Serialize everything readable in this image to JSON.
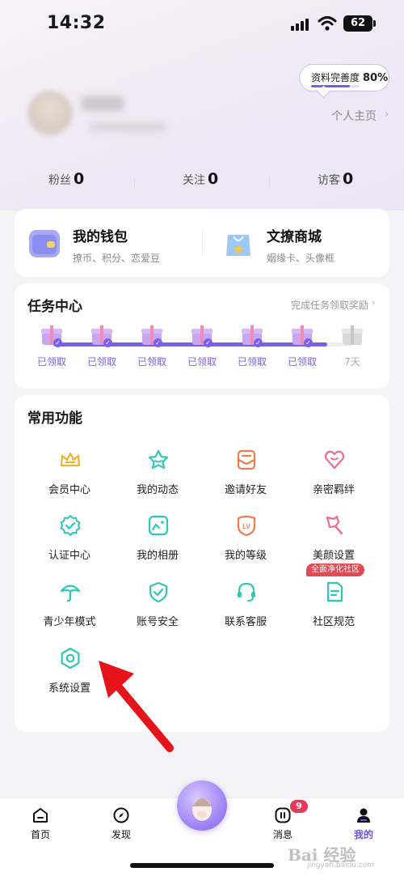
{
  "status_bar": {
    "time": "14:32",
    "battery": "62"
  },
  "profile": {
    "completion_label": "资料完善度",
    "completion_value": "80%",
    "completion_fraction": 0.8,
    "homepage_link": "个人主页"
  },
  "stats": [
    {
      "label": "粉丝",
      "value": "0"
    },
    {
      "label": "关注",
      "value": "0"
    },
    {
      "label": "访客",
      "value": "0"
    }
  ],
  "wallet": {
    "title": "我的钱包",
    "subtitle": "撩币、积分、恋爱豆",
    "mall_title": "文撩商城",
    "mall_subtitle": "姻缘卡、头像框"
  },
  "tasks": {
    "title": "任务中心",
    "hint": "完成任务领取奖励",
    "claimed_days": 6,
    "total_days": 7,
    "days": [
      "已领取",
      "已领取",
      "已领取",
      "已领取",
      "已领取",
      "已领取",
      "7天"
    ]
  },
  "functions": {
    "title": "常用功能",
    "items": [
      {
        "label": "会员中心",
        "icon": "crown-icon",
        "color": "#e9b52c"
      },
      {
        "label": "我的动态",
        "icon": "star-icon",
        "color": "#2ec9b5"
      },
      {
        "label": "邀请好友",
        "icon": "envelope-icon",
        "color": "#f07b4f"
      },
      {
        "label": "亲密羁绊",
        "icon": "heart-icon",
        "color": "#f06b8c"
      },
      {
        "label": "认证中心",
        "icon": "verified-badge-icon",
        "color": "#2ec9b5"
      },
      {
        "label": "我的相册",
        "icon": "photo-album-icon",
        "color": "#2ec9b5"
      },
      {
        "label": "我的等级",
        "icon": "level-icon",
        "color": "#f07b4f"
      },
      {
        "label": "美颜设置",
        "icon": "beauty-brush-icon",
        "color": "#f06b8c"
      },
      {
        "label": "青少年模式",
        "icon": "umbrella-icon",
        "color": "#2ec9b5"
      },
      {
        "label": "账号安全",
        "icon": "shield-check-icon",
        "color": "#2ec9b5"
      },
      {
        "label": "联系客服",
        "icon": "headset-icon",
        "color": "#2ec9b5"
      },
      {
        "label": "社区规范",
        "icon": "document-icon",
        "color": "#2ec9b5"
      },
      {
        "label": "系统设置",
        "icon": "settings-hexagon-icon",
        "color": "#2ec9b5"
      }
    ],
    "community_badge": "全面净化社区",
    "level_icon_text": "LV"
  },
  "tab_bar": {
    "items": [
      {
        "label": "首页",
        "icon": "home-icon"
      },
      {
        "label": "发现",
        "icon": "compass-icon"
      },
      {
        "label": "消息",
        "icon": "message-icon",
        "badge": "9"
      },
      {
        "label": "我的",
        "icon": "profile-icon",
        "active": true
      }
    ]
  },
  "watermark": {
    "text": "Bai 经验",
    "sub": "jingyan.baidu.com"
  },
  "colors": {
    "accent": "#7b60ee",
    "teal": "#2ec9b5",
    "arrow": "#e6131a"
  }
}
